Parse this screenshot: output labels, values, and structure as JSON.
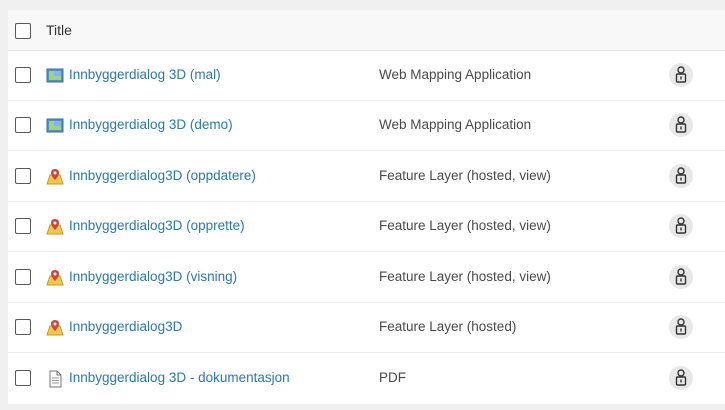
{
  "header": {
    "title_label": "Title"
  },
  "items": [
    {
      "title": "Innbyggerdialog 3D (mal)",
      "type": "Web Mapping Application",
      "icon": "web-map-app-icon"
    },
    {
      "title": "Innbyggerdialog 3D (demo)",
      "type": "Web Mapping Application",
      "icon": "web-map-app-icon"
    },
    {
      "title": "Innbyggerdialog3D (oppdatere)",
      "type": "Feature Layer (hosted, view)",
      "icon": "feature-layer-icon"
    },
    {
      "title": "Innbyggerdialog3D (opprette)",
      "type": "Feature Layer (hosted, view)",
      "icon": "feature-layer-icon"
    },
    {
      "title": "Innbyggerdialog3D (visning)",
      "type": "Feature Layer (hosted, view)",
      "icon": "feature-layer-icon"
    },
    {
      "title": "Innbyggerdialog3D",
      "type": "Feature Layer (hosted)",
      "icon": "feature-layer-icon"
    },
    {
      "title": "Innbyggerdialog 3D - dokumentasjon",
      "type": "PDF",
      "icon": "pdf-document-icon"
    }
  ],
  "share_icon": "person-lock-icon",
  "colors": {
    "link": "#2a7ab0",
    "header_bg": "#f8f8f8",
    "page_bg": "#f0f0f0"
  }
}
